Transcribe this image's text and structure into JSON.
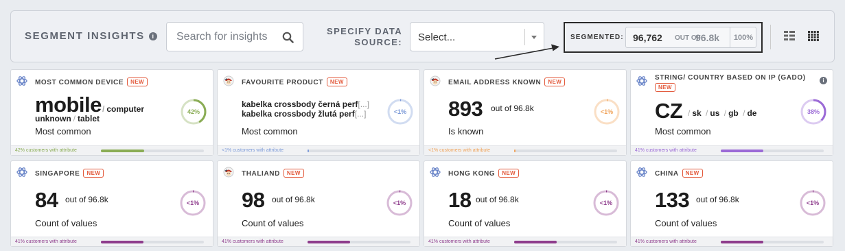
{
  "header": {
    "title": "SEGMENT INSIGHTS",
    "info_glyph": "i",
    "search_placeholder": "Search for insights",
    "data_source_label": "SPECIFY DATA SOURCE:",
    "select_value": "Select...",
    "segmented": {
      "label": "SEGMENTED:",
      "count": "96,762",
      "out_of": "OUT OF",
      "total": "96.8k",
      "percent": "100%"
    },
    "view_icons": [
      "list-view-icon",
      "grid-view-icon"
    ]
  },
  "cards": [
    {
      "title": "MOST COMMON DEVICE",
      "badge": "NEW",
      "main": "mobile",
      "others_line1": [
        "computer"
      ],
      "others_line2": [
        "unknown",
        "tablet"
      ],
      "sublabel": "Most common",
      "ring_text": "42%",
      "ring_value": 0.42,
      "color": "#8aac55",
      "footer": "42% customers with attribute",
      "bar_value": 0.42,
      "icon": "segment-source-icon"
    },
    {
      "title": "FAVOURITE PRODUCT",
      "badge": "NEW",
      "products": [
        "kabelka crossbody černá perf",
        "kabelka crossbody žlutá perf"
      ],
      "ellipsis": "[...]",
      "sublabel": "Most common",
      "ring_text": "<1%",
      "ring_value": 0.01,
      "color": "#7c9ad8",
      "footer": "<1% customers with attribute",
      "bar_value": 0.01,
      "icon": "mascot-source-icon"
    },
    {
      "title": "EMAIL ADDRESS KNOWN",
      "badge": "NEW",
      "main": "893",
      "of_text": "out of 96.8k",
      "sublabel": "Is known",
      "ring_text": "<1%",
      "ring_value": 0.01,
      "color": "#f0a35a",
      "footer": "<1% customers with attribute",
      "bar_value": 0.01,
      "icon": "mascot-source-icon"
    },
    {
      "title": "STRING/ COUNTRY BASED ON IP (GADO)",
      "badge": "NEW",
      "main": "CZ",
      "others": [
        "sk",
        "us",
        "gb",
        "de"
      ],
      "sublabel": "Most common",
      "ring_text": "38%",
      "ring_value": 0.38,
      "color": "#9b6ad6",
      "footer": "41% customers with attribute",
      "bar_value": 0.41,
      "icon": "segment-source-icon",
      "info_glyph": "i"
    },
    {
      "title": "SINGAPORE",
      "badge": "NEW",
      "main": "84",
      "of_text": "out of 96.8k",
      "sublabel": "Count of values",
      "ring_text": "<1%",
      "ring_value": 0.01,
      "color": "#8e3c8c",
      "footer": "41% customers with attribute",
      "bar_value": 0.41,
      "icon": "segment-source-icon"
    },
    {
      "title": "THALIAND",
      "badge": "NEW",
      "main": "98",
      "of_text": "out of 96.8k",
      "sublabel": "Count of values",
      "ring_text": "<1%",
      "ring_value": 0.01,
      "color": "#8e3c8c",
      "footer": "41% customers with attribute",
      "bar_value": 0.41,
      "icon": "mascot-source-icon"
    },
    {
      "title": "HONG KONG",
      "badge": "NEW",
      "main": "18",
      "of_text": "out of 96.8k",
      "sublabel": "Count of values",
      "ring_text": "<1%",
      "ring_value": 0.01,
      "color": "#8e3c8c",
      "footer": "41% customers with attribute",
      "bar_value": 0.41,
      "icon": "segment-source-icon"
    },
    {
      "title": "CHINA",
      "badge": "NEW",
      "main": "133",
      "of_text": "out of 96.8k",
      "sublabel": "Count of values",
      "ring_text": "<1%",
      "ring_value": 0.01,
      "color": "#8e3c8c",
      "footer": "41% customers with attribute",
      "bar_value": 0.41,
      "icon": "segment-source-icon"
    }
  ]
}
